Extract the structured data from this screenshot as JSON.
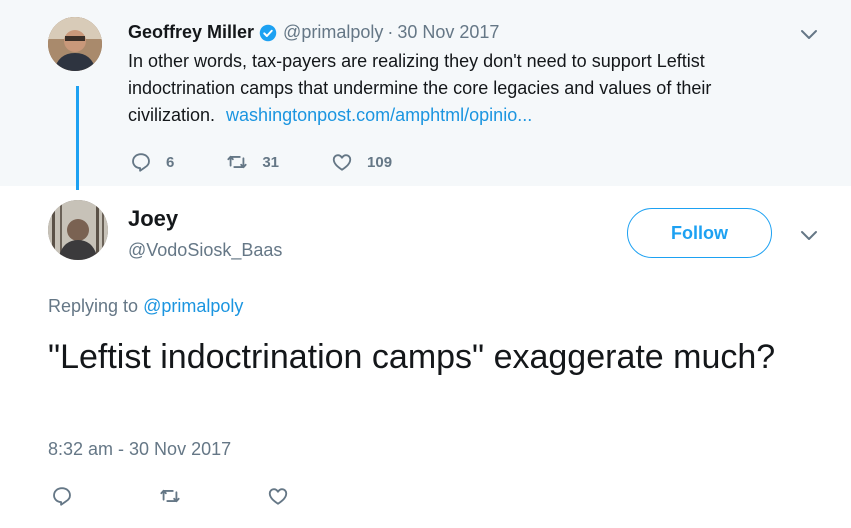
{
  "parent_tweet": {
    "name": "Geoffrey Miller",
    "handle": "@primalpoly",
    "separator": "·",
    "date": "30 Nov 2017",
    "text": "In other words, tax-payers are realizing they don't need to support Leftist indoctrination camps that undermine the core legacies and values of their civilization.",
    "link": "washingtonpost.com/amphtml/opinio...",
    "replies": "6",
    "retweets": "31",
    "likes": "109"
  },
  "reply_tweet": {
    "name": "Joey",
    "handle": "@VodoSiosk_Baas",
    "follow_label": "Follow",
    "replying_prefix": "Replying to",
    "replying_to": "@primalpoly",
    "text": "\"Leftist indoctrination camps\" exaggerate much?",
    "timestamp": "8:32 am - 30 Nov 2017"
  },
  "colors": {
    "accent": "#1da1f2",
    "link": "#1b95e0",
    "muted": "#657786",
    "parent_background": "#f5f8fa"
  },
  "icons": [
    "verified-badge-icon",
    "chevron-down-icon",
    "reply-icon",
    "retweet-icon",
    "like-icon"
  ]
}
